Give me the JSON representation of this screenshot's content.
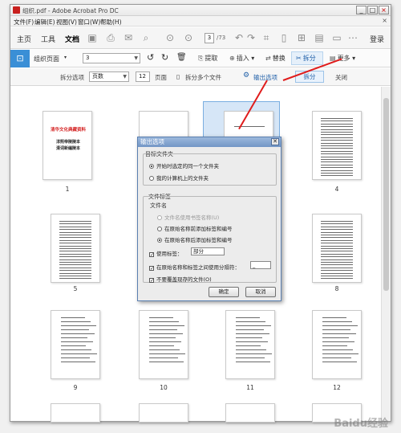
{
  "window": {
    "title": "组织.pdf - Adobe Acrobat Pro DC",
    "minimize": "_",
    "maximize": "□",
    "close": "×"
  },
  "menu": {
    "items": [
      "文件(F)",
      "编辑(E)",
      "视图(V)",
      "窗口(W)",
      "帮助(H)"
    ],
    "close_doc": "×"
  },
  "toolbar": {
    "tabs": [
      "主页",
      "工具",
      "文档"
    ],
    "active_tab": "文档",
    "page_current": "3",
    "page_total": "/73",
    "login": "登录"
  },
  "organize_bar": {
    "title": "组织页面",
    "page_select": "3",
    "buttons": {
      "extract": "提取",
      "insert": "插入",
      "replace": "替换",
      "split": "拆分",
      "more": "更多"
    }
  },
  "split_bar": {
    "split_options_label": "拆分选项",
    "split_by": "页数",
    "page_count": "12",
    "pages_label": "页面",
    "split_multiple": "拆分多个文件",
    "output_options": "输出选项",
    "split_button": "拆分",
    "close_button": "关闭"
  },
  "pages": [
    {
      "number": "1",
      "cover_title": "清华文化典藏资料",
      "cover_sub1": "淳熙帝陵陵本",
      "cover_sub2": "清词新编陵本"
    },
    {
      "number": "4"
    },
    {
      "number": "5"
    },
    {
      "number": "8"
    },
    {
      "number": "9"
    },
    {
      "number": "10"
    },
    {
      "number": "11"
    },
    {
      "number": "12"
    }
  ],
  "dialog": {
    "title": "输出选项",
    "target_folder_label": "目标文件夹",
    "opt_same_folder": "开始时选定的同一个文件夹",
    "opt_my_computer": "我的计算机上的文件夹",
    "file_label_group": "文件标签",
    "file_name_label": "文件名",
    "opt_bookmark_name": "文件名使用书签名称(U)",
    "opt_prefix": "在原始名称前添加标签和编号",
    "opt_suffix": "在原始名称后添加标签和编号",
    "use_label": "使用标签：",
    "label_value": "部分",
    "use_separator": "在原始名称和标签之间使用分隔符：",
    "separator_value": "_",
    "no_overwrite": "不要覆盖现存的文件(O)",
    "ok": "确定",
    "cancel": "取消"
  },
  "watermark": "Baidu经验",
  "colors": {
    "accent": "#3a8fd6",
    "arrow": "#e01c1c"
  }
}
